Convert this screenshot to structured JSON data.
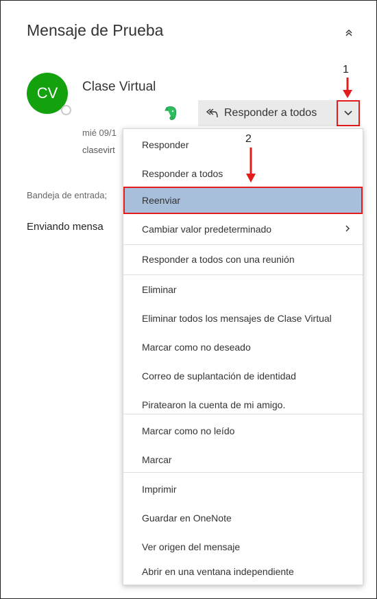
{
  "message": {
    "subject": "Mensaje de Prueba",
    "avatar_initials": "CV",
    "sender": "Clase Virtual",
    "date": "mié 09/1",
    "email": "clasevirt",
    "folder": "Bandeja de entrada;",
    "body_preview": "Enviando mensa"
  },
  "toolbar": {
    "reply_all_label": "Responder a todos"
  },
  "callouts": {
    "step1": "1",
    "step2": "2"
  },
  "menu": {
    "items": [
      {
        "label": "Responder"
      },
      {
        "label": "Responder a todos"
      },
      {
        "label": "Reenviar"
      },
      {
        "label": "Cambiar valor predeterminado"
      },
      {
        "label": "Responder a todos con una reunión"
      },
      {
        "label": "Eliminar"
      },
      {
        "label": "Eliminar todos los mensajes de Clase Virtual"
      },
      {
        "label": "Marcar como no deseado"
      },
      {
        "label": "Correo de suplantación de identidad"
      },
      {
        "label": "Piratearon la cuenta de mi amigo."
      },
      {
        "label": "Marcar como no leído"
      },
      {
        "label": "Marcar"
      },
      {
        "label": "Imprimir"
      },
      {
        "label": "Guardar en OneNote"
      },
      {
        "label": "Ver origen del mensaje"
      },
      {
        "label": "Abrir en una ventana independiente"
      }
    ]
  },
  "colors": {
    "avatar": "#13a10e",
    "highlight": "#a7bfdb",
    "callout_red": "#e41b1b"
  }
}
